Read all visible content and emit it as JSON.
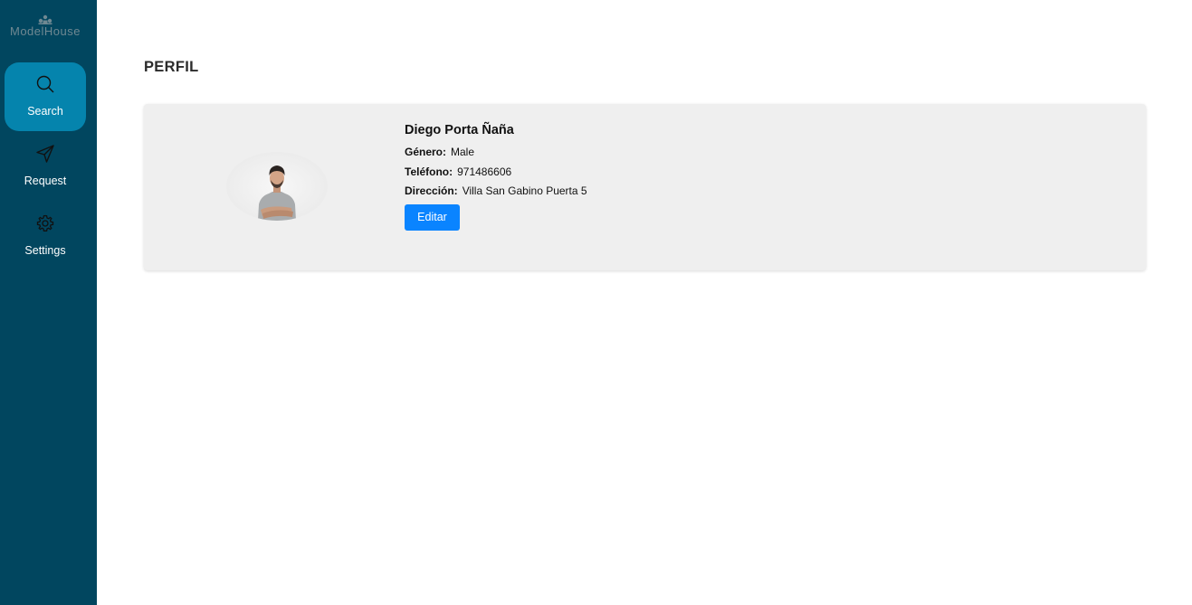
{
  "brand": {
    "name": "ModelHouse"
  },
  "sidebar": {
    "items": [
      {
        "label": "Search",
        "icon": "search-icon",
        "active": true
      },
      {
        "label": "Request",
        "icon": "send-icon",
        "active": false
      },
      {
        "label": "Settings",
        "icon": "gear-icon",
        "active": false
      }
    ]
  },
  "page": {
    "title": "PERFIL"
  },
  "profile": {
    "name": "Diego Porta Ñaña",
    "gender_label": "Género:",
    "gender": "Male",
    "phone_label": "Teléfono:",
    "phone": "971486606",
    "address_label": "Dirección:",
    "address": "Villa San Gabino Puerta 5",
    "edit_label": "Editar"
  },
  "colors": {
    "sidebar_bg": "#01465f",
    "active_item_bg": "#0584ad",
    "card_bg": "#efefef",
    "button_bg": "#0a84ff"
  }
}
